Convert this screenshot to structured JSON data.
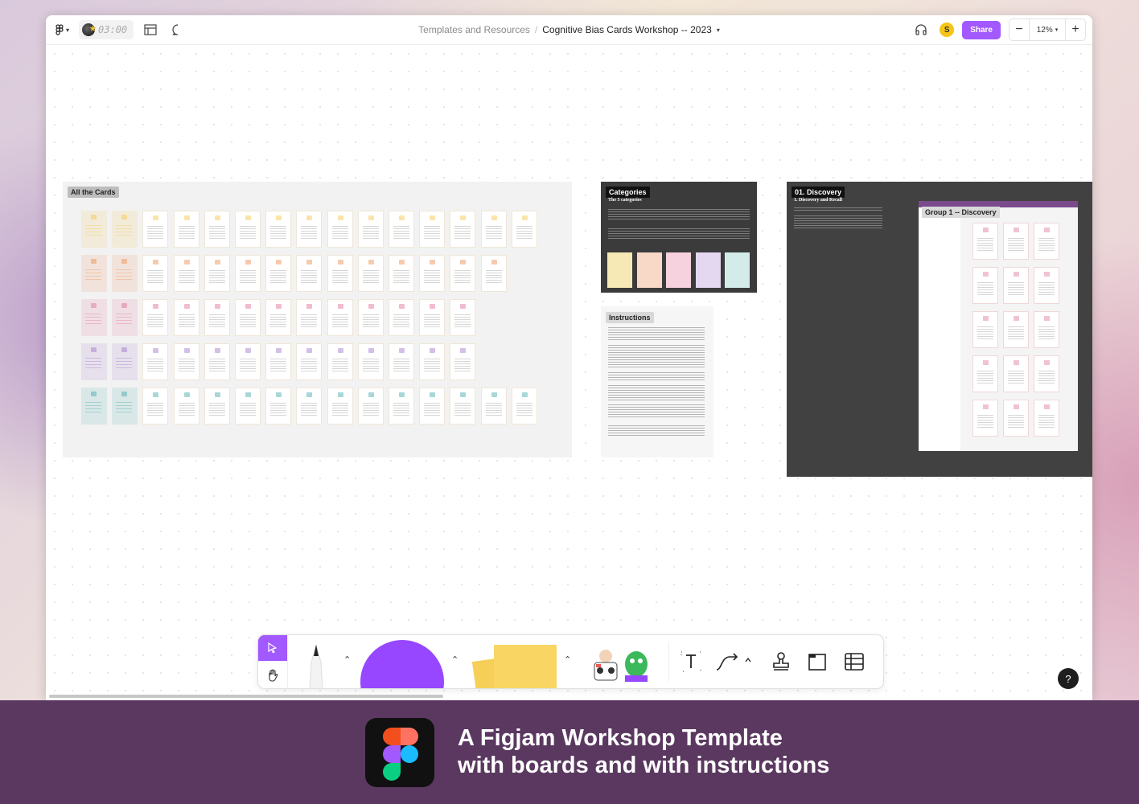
{
  "topbar": {
    "timer": "03:00",
    "breadcrumb_parent": "Templates and Resources",
    "breadcrumb_separator": "/",
    "file_name": "Cognitive Bias Cards Workshop -- 2023",
    "user_initial": "S",
    "share_label": "Share",
    "zoom_level": "12%"
  },
  "canvas": {
    "all_cards": {
      "label": "All the Cards"
    },
    "categories": {
      "label": "Categories",
      "subtitle": "The 5 categories"
    },
    "instructions": {
      "label": "Instructions"
    },
    "discovery": {
      "label": "01. Discovery",
      "subtitle": "1. Discovery and Recall",
      "group_label": "Group 1 -- Discovery"
    }
  },
  "card_rows": [
    {
      "color": "#f6c445",
      "count": 15
    },
    {
      "color": "#ef8a4a",
      "count": 14
    },
    {
      "color": "#e06a96",
      "count": 13
    },
    {
      "color": "#a071c8",
      "count": 13
    },
    {
      "color": "#3fa7a8",
      "count": 15
    }
  ],
  "category_colors": [
    "#f7e9b5",
    "#f8d9c7",
    "#f6d1de",
    "#e4d7f0",
    "#d3ecea"
  ],
  "help_label": "?",
  "banner": {
    "title_line1": "A Figjam Workshop Template",
    "title_line2": "with boards and  with instructions"
  }
}
